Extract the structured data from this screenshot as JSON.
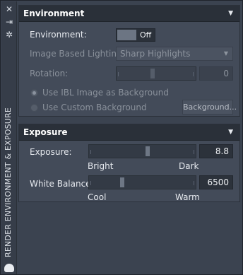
{
  "sidebar": {
    "title": "RENDER ENVIRONMENT & EXPOSURE",
    "icons": [
      "close-icon",
      "pin-icon",
      "settings-icon"
    ]
  },
  "environment": {
    "title": "Environment",
    "env_label": "Environment:",
    "env_toggle": "Off",
    "ibl_label": "Image Based Lighting:",
    "ibl_value": "Sharp Highlights",
    "rotation_label": "Rotation:",
    "rotation_value": "0",
    "rotation_level": 0.45,
    "radio_ibl": "Use IBL Image as Background",
    "radio_custom": "Use Custom Background",
    "background_button": "Background..."
  },
  "exposure": {
    "title": "Exposure",
    "exposure_label": "Exposure:",
    "exposure_value": "8.8",
    "exposure_level": 0.55,
    "bright": "Bright",
    "dark": "Dark",
    "wb_label": "White Balance:",
    "wb_value": "6500",
    "wb_level": 0.3,
    "cool": "Cool",
    "warm": "Warm"
  }
}
